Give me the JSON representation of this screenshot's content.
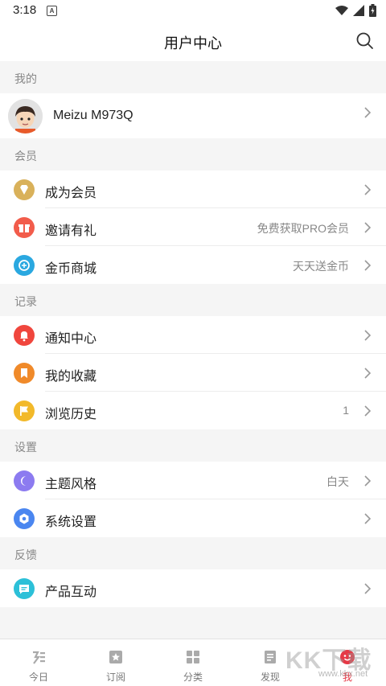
{
  "status": {
    "time": "3:18",
    "notif_letter": "A"
  },
  "header": {
    "title": "用户中心",
    "search_icon": "search-icon"
  },
  "sections": {
    "mine": "我的",
    "member": "会员",
    "records": "记录",
    "settings": "设置",
    "feedback": "反馈"
  },
  "profile": {
    "name": "Meizu M973Q"
  },
  "member_rows": [
    {
      "label": "成为会员",
      "value": "",
      "icon": "diamond-icon",
      "color": "#d9b15a"
    },
    {
      "label": "邀请有礼",
      "value": "免费获取PRO会员",
      "icon": "gift-icon",
      "color": "#f25c4b"
    },
    {
      "label": "金币商城",
      "value": "天天送金币",
      "icon": "coin-icon",
      "color": "#2aa8e0"
    }
  ],
  "record_rows": [
    {
      "label": "通知中心",
      "value": "",
      "icon": "bell-icon",
      "color": "#f0463d"
    },
    {
      "label": "我的收藏",
      "value": "",
      "icon": "bookmark-icon",
      "color": "#f08a2a"
    },
    {
      "label": "浏览历史",
      "value": "1",
      "icon": "flag-icon",
      "color": "#f2b92a"
    }
  ],
  "settings_rows": [
    {
      "label": "主题风格",
      "value": "白天",
      "icon": "moon-icon",
      "color": "#8c7bf0"
    },
    {
      "label": "系统设置",
      "value": "",
      "icon": "hexagon-icon",
      "color": "#4a86f0"
    }
  ],
  "feedback_rows": [
    {
      "label": "产品互动",
      "value": "",
      "icon": "chat-icon",
      "color": "#2cc0d8"
    }
  ],
  "bottom_nav": [
    {
      "label": "今日",
      "icon": "today-icon"
    },
    {
      "label": "订阅",
      "icon": "subscribe-icon"
    },
    {
      "label": "分类",
      "icon": "category-icon"
    },
    {
      "label": "发现",
      "icon": "discover-icon"
    },
    {
      "label": "我",
      "icon": "me-icon",
      "active": true
    }
  ],
  "accent_color": "#e63946",
  "watermark": {
    "big": "KK下载",
    "small": "www.kkx.net"
  }
}
